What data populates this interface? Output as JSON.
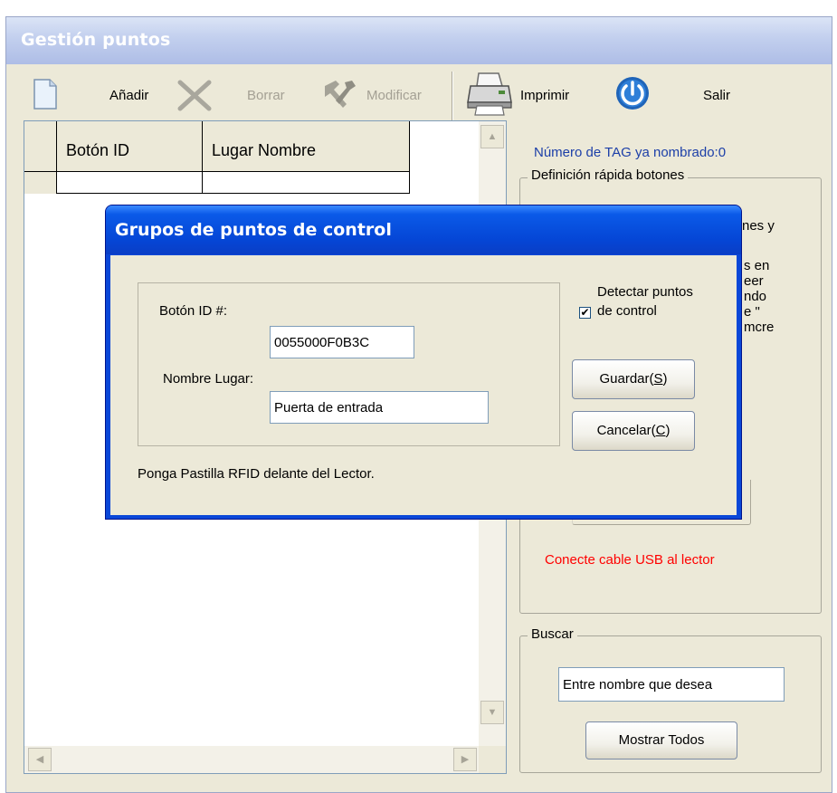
{
  "window": {
    "title": "Gestión puntos"
  },
  "toolbar": {
    "add_label": "Añadir",
    "delete_label": "Borrar",
    "modify_label": "Modificar",
    "print_label": "Imprimir",
    "exit_label": "Salir"
  },
  "grid": {
    "columns": [
      "Botón ID",
      "Lugar Nombre"
    ]
  },
  "right_panel": {
    "tag_count_text": "Número de TAG ya nombrado:0",
    "quick_def_legend": "Definición rápida botones",
    "partial_text_lines": [
      "nes y",
      "s en",
      "eer",
      "ndo",
      "e \"",
      "mcre"
    ],
    "usb_status": "Conecte cable USB al lector",
    "usb_status_color": "#ff0000",
    "search_legend": "Buscar",
    "search_value": "Entre nombre que desea",
    "show_all_label": "Mostrar Todos"
  },
  "dialog": {
    "title": "Grupos de puntos de control",
    "button_id_label": "Botón ID #:",
    "button_id_value": "0055000F0B3C",
    "place_name_label": "Nombre Lugar:",
    "place_name_value": "Puerta de entrada",
    "detect_checkbox_label": "Detectar puntos de control",
    "detect_checked": true,
    "save_label_prefix": "Guardar(",
    "save_label_key": "S",
    "save_label_suffix": ")",
    "cancel_label_prefix": "Cancelar(",
    "cancel_label_key": "C",
    "cancel_label_suffix": ")",
    "hint_text": "Ponga Pastilla RFID delante del Lector."
  }
}
